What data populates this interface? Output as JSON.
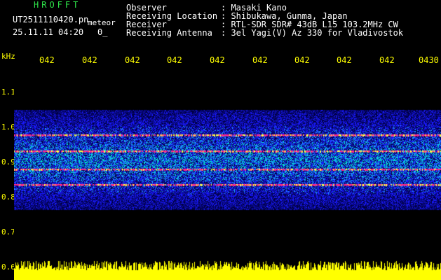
{
  "header": {
    "app_name": "HROFFT",
    "file_name": "UT2511110420.pn",
    "meteor_label": "meteor",
    "datetime": "25.11.11 04:20",
    "zero_label": "0_",
    "observer_label": "Observer",
    "observer_value": ": Masaki Kano",
    "location_label": "Receiving Location",
    "location_value": ": Shibukawa, Gunma, Japan",
    "receiver_label": "Receiver",
    "receiver_value": ": RTL-SDR SDR# 43dB L15 103.2MHz CW",
    "antenna_label": "Receiving Antenna",
    "antenna_value": ": 3el Yagi(V) Az 330 for Vladivostok"
  },
  "axis": {
    "unit": "kHz",
    "y_ticks": [
      "1.1",
      "1.0",
      "0.9",
      "0.8",
      "0.7",
      "0.6"
    ],
    "time_ticks": [
      "042",
      "042",
      "042",
      "042",
      "042",
      "042",
      "042",
      "042",
      "042",
      "0430"
    ]
  },
  "colors": {
    "text_green": "#2ee64a",
    "text_white": "#ffffff",
    "axis_yellow": "#ffff00",
    "background": "#000000",
    "band_low": "#1a1aff",
    "band_mid": "#00e0d0",
    "band_high": "#ff2a8a"
  }
}
